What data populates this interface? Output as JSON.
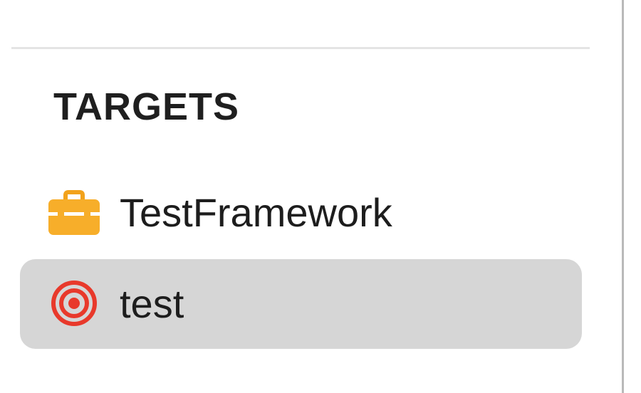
{
  "sidebar": {
    "section_title": "TARGETS",
    "items": [
      {
        "label": "TestFramework",
        "icon": "toolbox-icon",
        "icon_color": "#F5A623",
        "selected": false
      },
      {
        "label": "test",
        "icon": "target-icon",
        "icon_color": "#E8392B",
        "selected": true
      }
    ]
  },
  "colors": {
    "selection_background": "#D6D6D6",
    "divider": "#E4E4E4"
  }
}
